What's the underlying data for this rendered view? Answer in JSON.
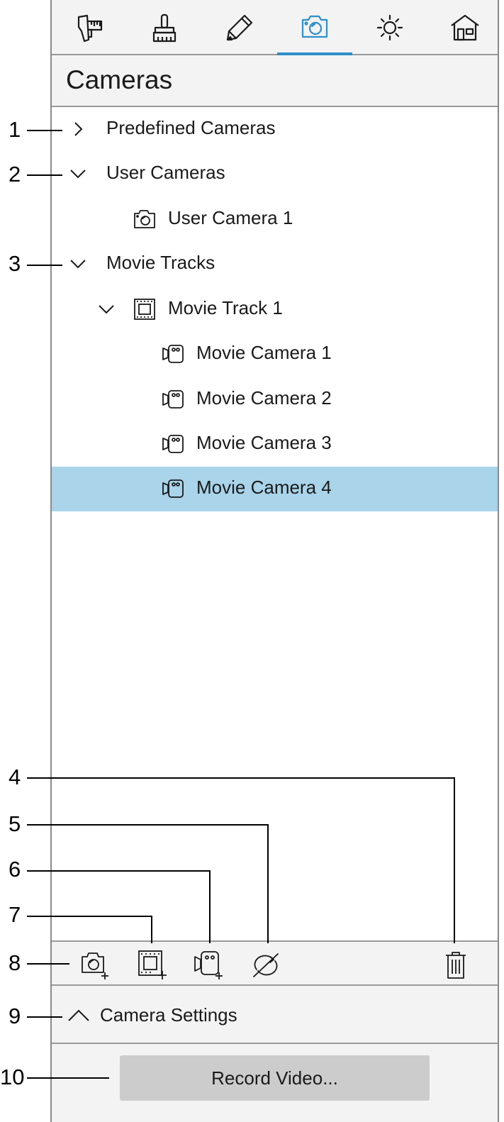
{
  "toolbar": {
    "tabs": [
      {
        "icon": "caliper-icon"
      },
      {
        "icon": "brush-icon"
      },
      {
        "icon": "pencil-icon"
      },
      {
        "icon": "camera-icon",
        "active": true
      },
      {
        "icon": "sun-icon"
      },
      {
        "icon": "house-icon"
      }
    ],
    "accent_color": "#2e8fc9"
  },
  "panel": {
    "title": "Cameras"
  },
  "tree": {
    "predefined": "Predefined Cameras",
    "user_cameras": "User Cameras",
    "user_camera_1": "User Camera 1",
    "movie_tracks": "Movie Tracks",
    "movie_track_1": "Movie Track 1",
    "movie_cameras": [
      "Movie Camera 1",
      "Movie Camera 2",
      "Movie Camera 3",
      "Movie Camera 4"
    ],
    "selected_color": "#a9d4ea"
  },
  "actions": [
    {
      "icon": "add-camera-icon"
    },
    {
      "icon": "add-movie-track-icon"
    },
    {
      "icon": "add-movie-camera-icon"
    },
    {
      "icon": "sync-camera-icon"
    },
    {
      "icon": "trash-icon"
    }
  ],
  "settings": {
    "label": "Camera Settings"
  },
  "record": {
    "label": "Record Video..."
  },
  "callouts": [
    "1",
    "2",
    "3",
    "4",
    "5",
    "6",
    "7",
    "8",
    "9",
    "10"
  ]
}
